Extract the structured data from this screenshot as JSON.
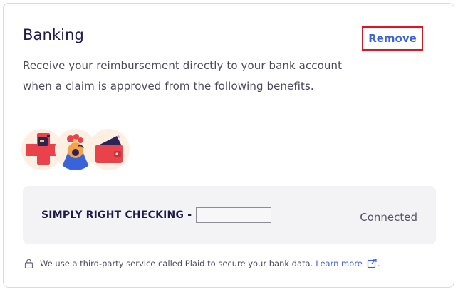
{
  "card": {
    "title": "Banking",
    "remove_label": "Remove",
    "description": "Receive your reimbursement directly to your bank account when a claim is approved from the following benefits."
  },
  "benefits": [
    {
      "icon": "medical-benefit-icon"
    },
    {
      "icon": "dental-benefit-icon"
    },
    {
      "icon": "wallet-benefit-icon"
    }
  ],
  "account": {
    "name": "SIMPLY RIGHT CHECKING -",
    "status": "Connected"
  },
  "footer": {
    "notice": "We use a third-party service called Plaid to secure your bank data.",
    "learn_more": "Learn more",
    "period": "."
  },
  "colors": {
    "accent": "#3b63d9",
    "highlight_border": "#e3121b",
    "title": "#1e1b4b",
    "panel_bg": "#f3f3f6"
  }
}
